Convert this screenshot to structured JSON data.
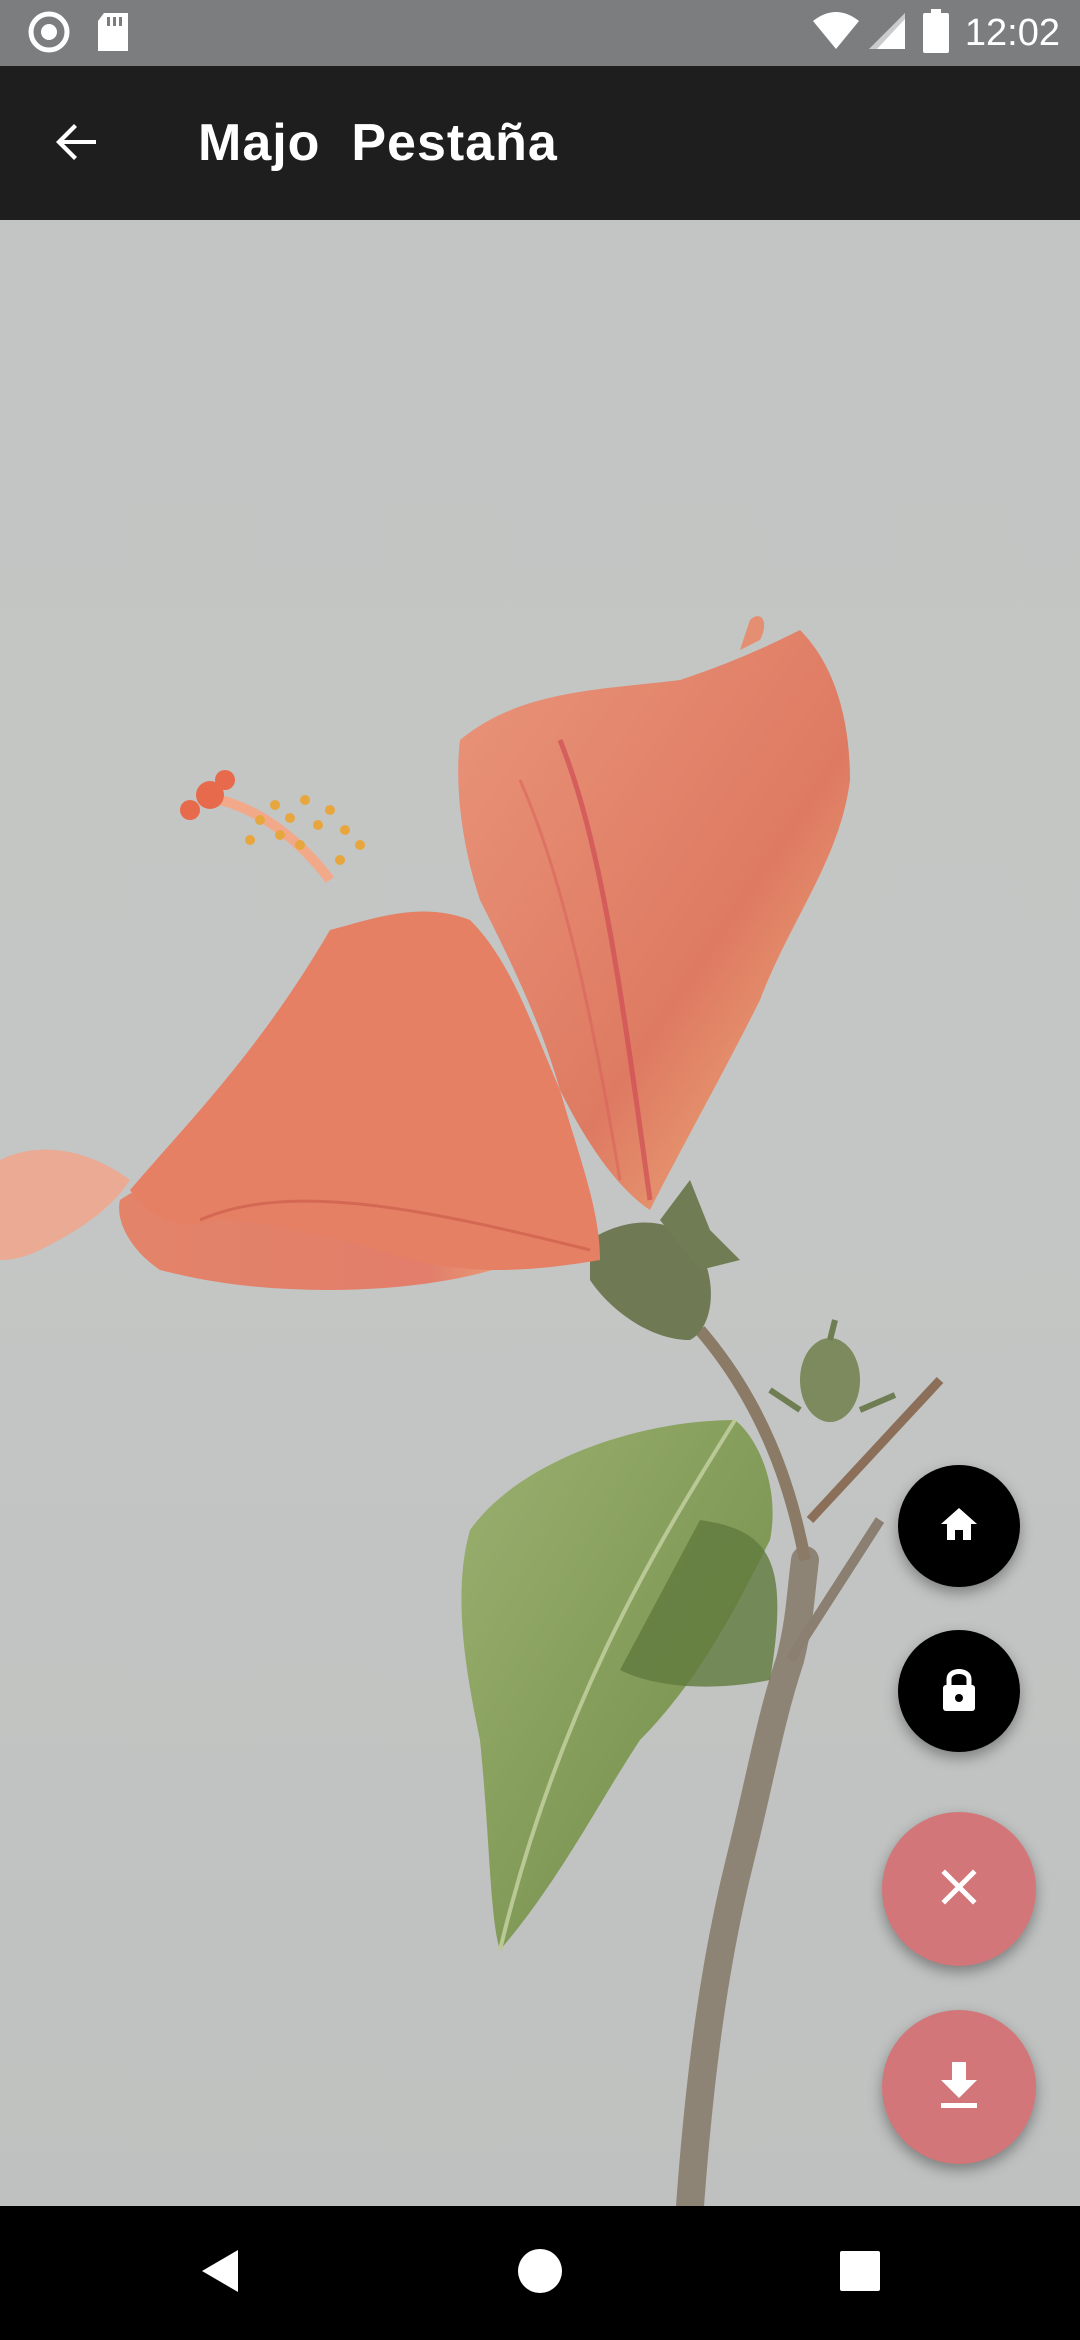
{
  "status_bar": {
    "time": "12:02",
    "icons": [
      "record-icon",
      "sd-card-icon",
      "wifi-icon",
      "signal-icon",
      "battery-icon"
    ]
  },
  "app_bar": {
    "title": "Majo  Pestaña",
    "back_icon": "arrow-back-icon"
  },
  "photo": {
    "subject": "hibiscus-flower-photo"
  },
  "fabs": [
    {
      "icon": "home-icon",
      "color": "#000000"
    },
    {
      "icon": "lock-icon",
      "color": "#000000"
    },
    {
      "icon": "close-icon",
      "color": "#d37679"
    },
    {
      "icon": "download-icon",
      "color": "#d37679"
    }
  ],
  "nav_bar": {
    "icons": [
      "back-triangle-icon",
      "home-circle-icon",
      "recents-square-icon"
    ]
  },
  "colors": {
    "status_bar": "#7b7d7f",
    "app_bar": "#1e1e1e",
    "background": "#c4c6c5",
    "accent": "#d37679"
  }
}
